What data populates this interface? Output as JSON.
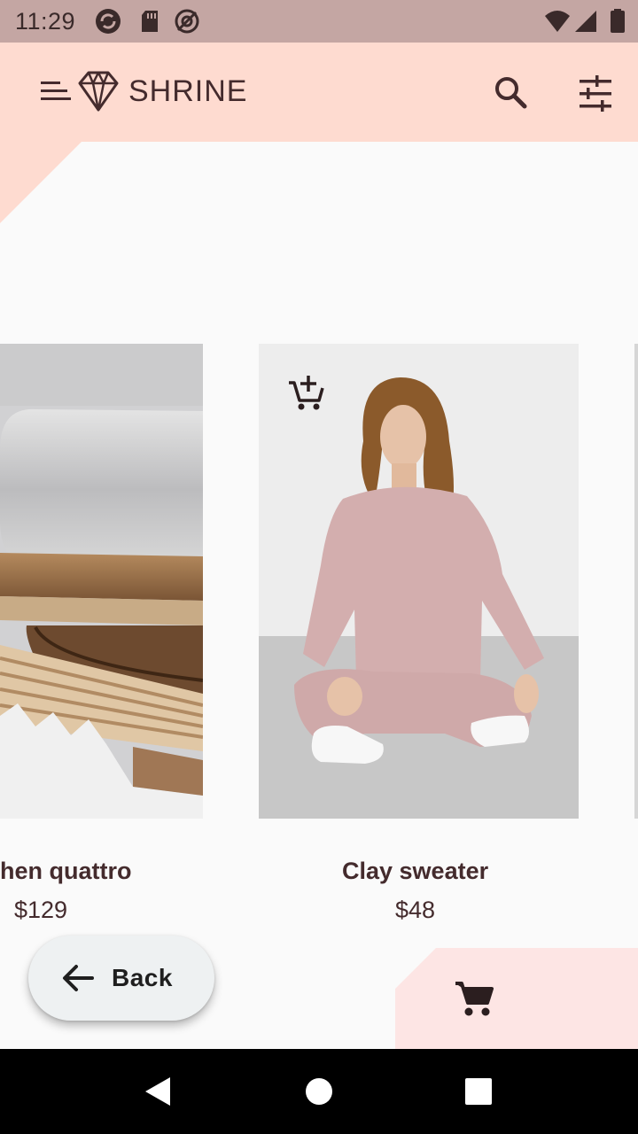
{
  "status_bar": {
    "time": "11:29",
    "left_icons": [
      "sync-icon",
      "sd-card-icon",
      "at-sign-icon"
    ],
    "right_icons": [
      "wifi-icon",
      "signal-icon",
      "battery-icon"
    ]
  },
  "app_bar": {
    "title": "SHRINE",
    "icons": [
      "menu-icon",
      "shrine-logo-icon",
      "search-icon",
      "tune-icon"
    ]
  },
  "products": [
    {
      "name": "hen quattro",
      "price": "$129"
    },
    {
      "name": "Clay sweater",
      "price": "$48"
    }
  ],
  "back_button": {
    "label": "Back"
  },
  "cart": {
    "icon": "shopping-cart-icon"
  },
  "colors": {
    "primary": "#fedbd0",
    "status_bar": "#c4a6a3",
    "on_primary": "#442b2d",
    "background": "#fafafa",
    "cart_panel": "#fde5e4"
  }
}
